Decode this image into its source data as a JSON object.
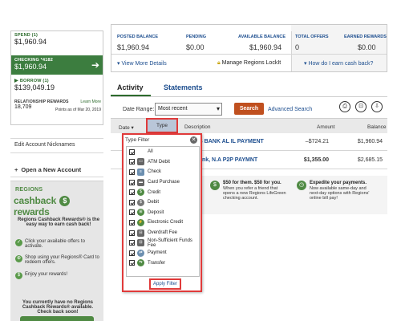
{
  "accounts": {
    "spend": {
      "title": "SPEND (1)",
      "value": "$1,960.94"
    },
    "checking": {
      "title": "CHECKING *4182",
      "value": "$1,960.94"
    },
    "borrow": {
      "title": "BORROW (1)",
      "value": "$139,049.19"
    },
    "rewards": {
      "title": "RELATIONSHIP REWARDS",
      "learn_more": "Learn More",
      "points": "18,709",
      "points_date": "Points as of Mar 20, 2019"
    },
    "edit_nicknames": "Edit Account Nicknames",
    "open_account": "Open a New Account"
  },
  "cashback": {
    "brand": "REGIONS",
    "logo_left": "cashback",
    "logo_right": "rewards",
    "description": "Regions Cashback Rewards® is the easy way to earn cash back!",
    "steps": [
      "Click your available offers to activate.",
      "Shop using your Regions® Card to redeem offers.",
      "Enjoy your rewards!"
    ],
    "none_text": "You currently have no Regions Cashback Rewards® available. Check back soon!"
  },
  "summary": {
    "posted_label": "POSTED BALANCE",
    "posted_value": "$1,960.94",
    "pending_label": "PENDING",
    "pending_value": "$0.00",
    "available_label": "AVAILABLE BALANCE",
    "available_value": "$1,960.94",
    "offers_label": "TOTAL OFFERS",
    "offers_value": "0",
    "earned_label": "EARNED REWARDS",
    "earned_value": "$0.00",
    "view_more": "View More Details",
    "lockit": "Manage Regions LockIt",
    "cashback_q": "How do I earn cash back?"
  },
  "tabs": {
    "activity": "Activity",
    "statements": "Statements"
  },
  "filters": {
    "date_range_label": "Date Range:",
    "date_range_value": "Most recent",
    "search": "Search",
    "advanced": "Advanced Search"
  },
  "table": {
    "headers": {
      "date": "Date",
      "type": "Type",
      "description": "Description",
      "amount": "Amount",
      "balance": "Balance"
    },
    "rows": [
      {
        "description": "NS BANK AL IL PAYMENT",
        "amount": "–$724.21",
        "balance": "$1,960.94"
      },
      {
        "description": "Bank, N.A P2P PAYMNT",
        "amount": "$1,355.00",
        "balance": "$2,685.15"
      }
    ]
  },
  "promo": {
    "p1_title": "$50 for them. $50 for you.",
    "p1_text": "When you refer a friend that opens a new Regions LifeGreen checking account.",
    "p2_title": "Expedite your payments.",
    "p2_text": "Now available same-day and next-day options with Regions' online bill pay!"
  },
  "type_filter": {
    "title": "Type Filter",
    "items": [
      "All",
      "ATM Debit",
      "Check",
      "Card Purchase",
      "Credit",
      "Debit",
      "Deposit",
      "Electronic Credit",
      "Overdraft Fee",
      "Non-Sufficient Funds Fee",
      "Payment",
      "Transfer"
    ],
    "apply": "Apply Filter"
  },
  "colors": {
    "brand_green": "#3c7d3f",
    "link_blue": "#1d4e8f",
    "search_orange": "#c0501f",
    "highlight_red": "#e03a3a"
  }
}
